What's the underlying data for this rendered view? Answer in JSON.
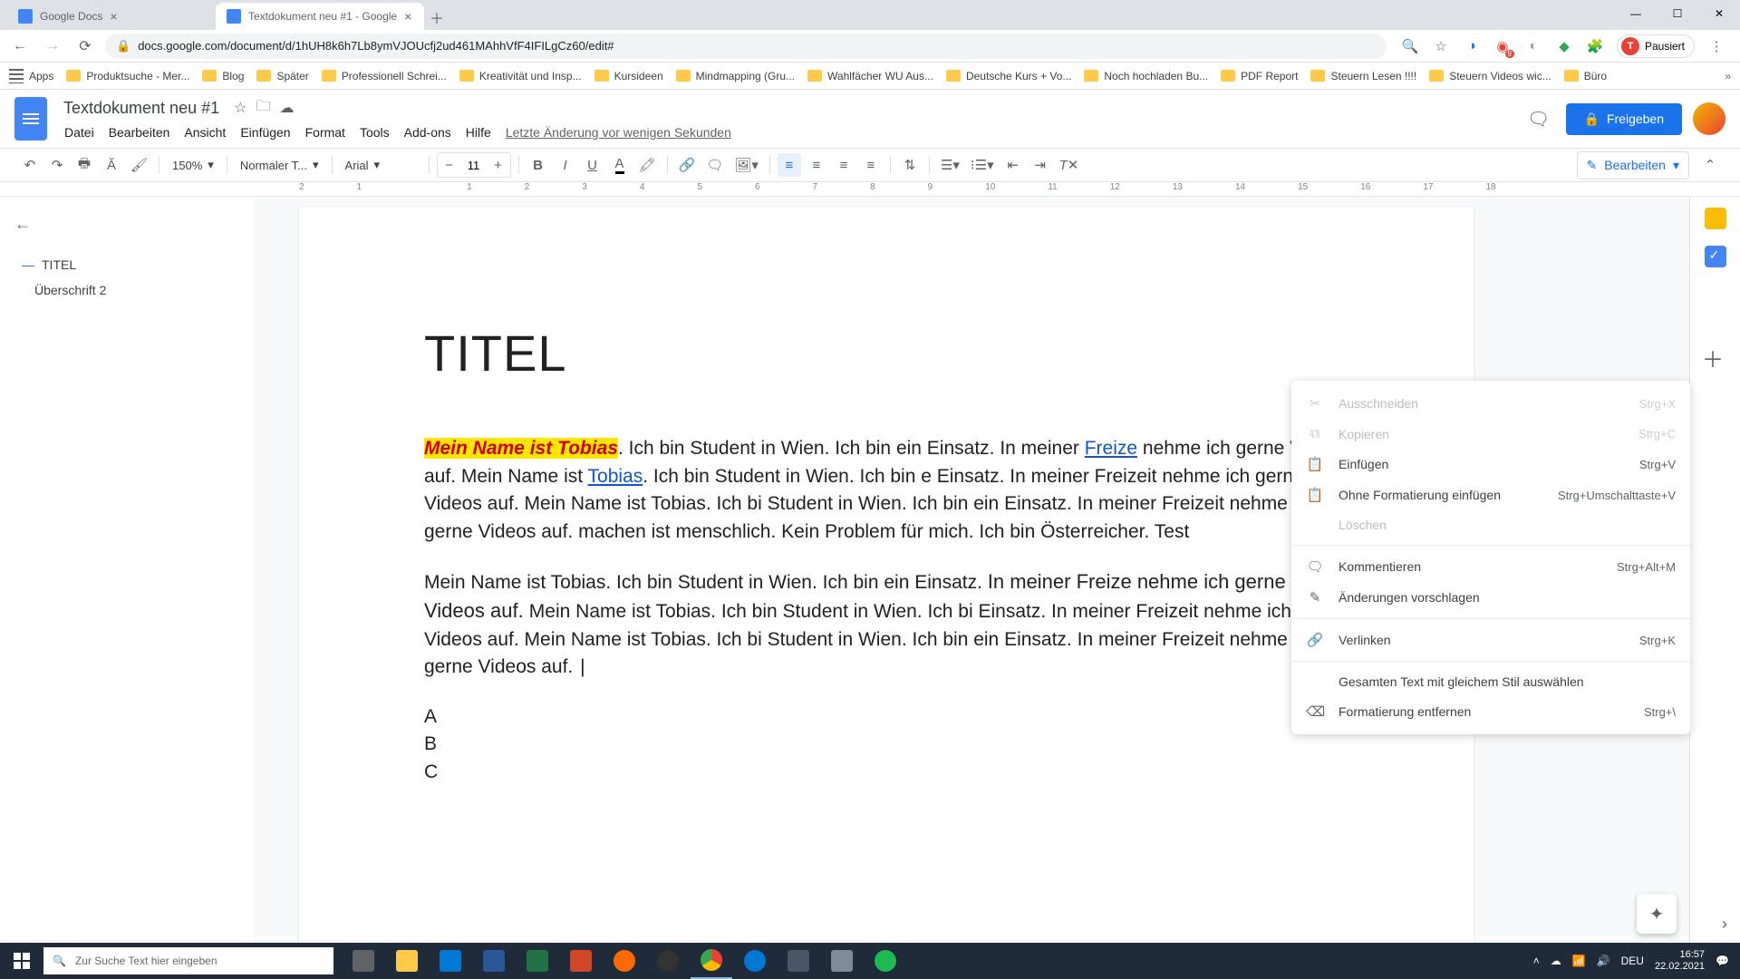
{
  "browser": {
    "tabs": [
      {
        "title": "Google Docs",
        "active": false
      },
      {
        "title": "Textdokument neu #1 - Google ",
        "active": true
      }
    ],
    "url": "docs.google.com/document/d/1hUH8k6h7Lb8ymVJOUcfj2ud461MAhhVfF4IFILgCz60/edit#",
    "pause_label": "Pausiert",
    "bookmarks": [
      "Apps",
      "Produktsuche - Mer...",
      "Blog",
      "Später",
      "Professionell Schrei...",
      "Kreativität und Insp...",
      "Kursideen",
      "Mindmapping (Gru...",
      "Wahlfächer WU Aus...",
      "Deutsche Kurs + Vo...",
      "Noch hochladen Bu...",
      "PDF Report",
      "Steuern Lesen !!!!",
      "Steuern Videos wic...",
      "Büro"
    ]
  },
  "docs": {
    "title": "Textdokument neu #1",
    "menus": [
      "Datei",
      "Bearbeiten",
      "Ansicht",
      "Einfügen",
      "Format",
      "Tools",
      "Add-ons",
      "Hilfe"
    ],
    "last_change": "Letzte Änderung vor wenigen Sekunden",
    "share": "Freigeben",
    "zoom": "150%",
    "style": "Normaler T...",
    "font": "Arial",
    "font_size": "11",
    "edit_mode": "Bearbeiten"
  },
  "outline": {
    "items": [
      {
        "text": "TITEL",
        "level": 1
      },
      {
        "text": "Überschrift 2",
        "level": 2
      }
    ]
  },
  "content": {
    "heading": "TITEL",
    "p1_hl": "Mein Name ist Tobias",
    "p1_a": ". Ich bin Student in Wien. Ich bin ein Einsatz. In meiner ",
    "p1_link1": "Freize",
    "p1_b": " nehme ich gerne Videos auf. Mein Name ist ",
    "p1_link2": "Tobias",
    "p1_c": ". Ich bin Student in Wien. Ich bin e Einsatz. In meiner Freizeit nehme ich gerne Videos auf. Mein Name ist Tobias. Ich bi Student in Wien. Ich bin ein Einsatz. In meiner Freizeit nehme ich gerne Videos auf. machen ist menschlich. Kein Problem für mich. Ich bin Österreicher. Test",
    "p2_a": "Mein Name ist Tobias. Ich bin Student in Wien. Ich bin ein Einsatz. ",
    "p2_b": "In meiner Freize nehme ich gerne Videos auf. ",
    "p2_c": "Mein Name ist Tobias. Ich bin Student in Wien. Ich bi Einsatz. In meiner Freizeit nehme ich gerne Videos auf. Mein Name ist Tobias. Ich bi Student in Wien. Ich bin ein Einsatz. In meiner Freizeit nehme ich gerne Videos auf.",
    "list": [
      "A",
      "B",
      "C"
    ]
  },
  "context_menu": [
    {
      "icon": "✂",
      "label": "Ausschneiden",
      "shortcut": "Strg+X",
      "disabled": true
    },
    {
      "icon": "⧉",
      "label": "Kopieren",
      "shortcut": "Strg+C",
      "disabled": true
    },
    {
      "icon": "📋",
      "label": "Einfügen",
      "shortcut": "Strg+V",
      "disabled": false
    },
    {
      "icon": "📋",
      "label": "Ohne Formatierung einfügen",
      "shortcut": "Strg+Umschalttaste+V",
      "disabled": false
    },
    {
      "icon": "",
      "label": "Löschen",
      "shortcut": "",
      "disabled": true
    },
    {
      "divider": true
    },
    {
      "icon": "🗨",
      "label": "Kommentieren",
      "shortcut": "Strg+Alt+M",
      "disabled": false
    },
    {
      "icon": "✎",
      "label": "Änderungen vorschlagen",
      "shortcut": "",
      "disabled": false
    },
    {
      "divider": true
    },
    {
      "icon": "🔗",
      "label": "Verlinken",
      "shortcut": "Strg+K",
      "disabled": false
    },
    {
      "divider": true
    },
    {
      "icon": "",
      "label": "Gesamten Text mit gleichem Stil auswählen",
      "shortcut": "",
      "disabled": false
    },
    {
      "icon": "⌫",
      "label": "Formatierung entfernen",
      "shortcut": "Strg+\\",
      "disabled": false
    }
  ],
  "ruler": [
    "2",
    "1",
    "",
    "1",
    "2",
    "3",
    "4",
    "5",
    "6",
    "7",
    "8",
    "9",
    "10",
    "11",
    "12",
    "13",
    "14",
    "15",
    "16",
    "17",
    "18"
  ],
  "taskbar": {
    "search_placeholder": "Zur Suche Text hier eingeben",
    "lang": "DEU",
    "time": "16:57",
    "date": "22.02.2021"
  }
}
